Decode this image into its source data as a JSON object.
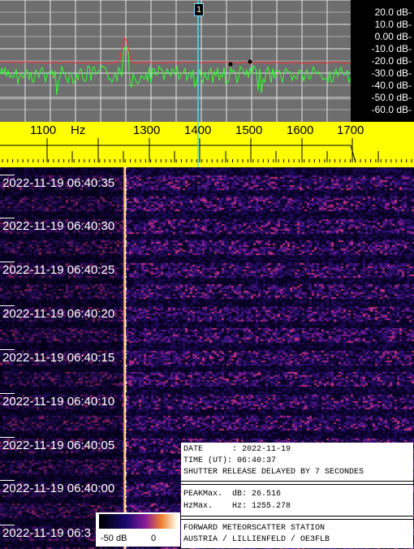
{
  "spectrum": {
    "db_labels": [
      "20.0 dB-",
      "10.0 dB-",
      "0.00 dB-",
      "-10.0 dB-",
      "-20.0 dB-",
      "-30.0 dB-",
      "-40.0 dB-",
      "-50.0 dB-",
      "-60.0 dB-"
    ],
    "marker_label": "1",
    "colors": {
      "background": "#6e6e6e",
      "grid": "#e8e8e8",
      "trace": "#33ff33",
      "average": "#ff3030",
      "marker": "#40e0f0"
    }
  },
  "ruler": {
    "unit_label": "Hz",
    "freq_labels": [
      "1100",
      "1300",
      "1400",
      "1500",
      "1600",
      "1700"
    ],
    "colors": {
      "background": "#ffff00"
    }
  },
  "waterfall": {
    "timestamps": [
      "2022-11-19 06:40:35",
      "2022-11-19 06:40:30",
      "2022-11-19 06:40:25",
      "2022-11-19 06:40:20",
      "2022-11-19 06:40:15",
      "2022-11-19 06:40:10",
      "2022-11-19 06:40:05",
      "2022-11-19 06:40:00",
      "2022-11-19 06:3"
    ]
  },
  "info": {
    "date_line": "DATE      : 2022-11-19",
    "time_line": "TIME (UT): 06:40:37",
    "shutter_line": "SHUTTER RELEASE DELAYED BY 7 SECONDES",
    "separator": "==========================================",
    "peak_db_line": "PEAKMax.  dB: 26.516",
    "peak_hz_line": "HzMax.    Hz: 1255.278",
    "station_line": "FORWARD METEORSCATTER STATION",
    "location_line": "AUSTRIA / LILLIENFELD / OE3FLB"
  },
  "scale": {
    "min_label": "-50 dB",
    "max_label": "0"
  }
}
